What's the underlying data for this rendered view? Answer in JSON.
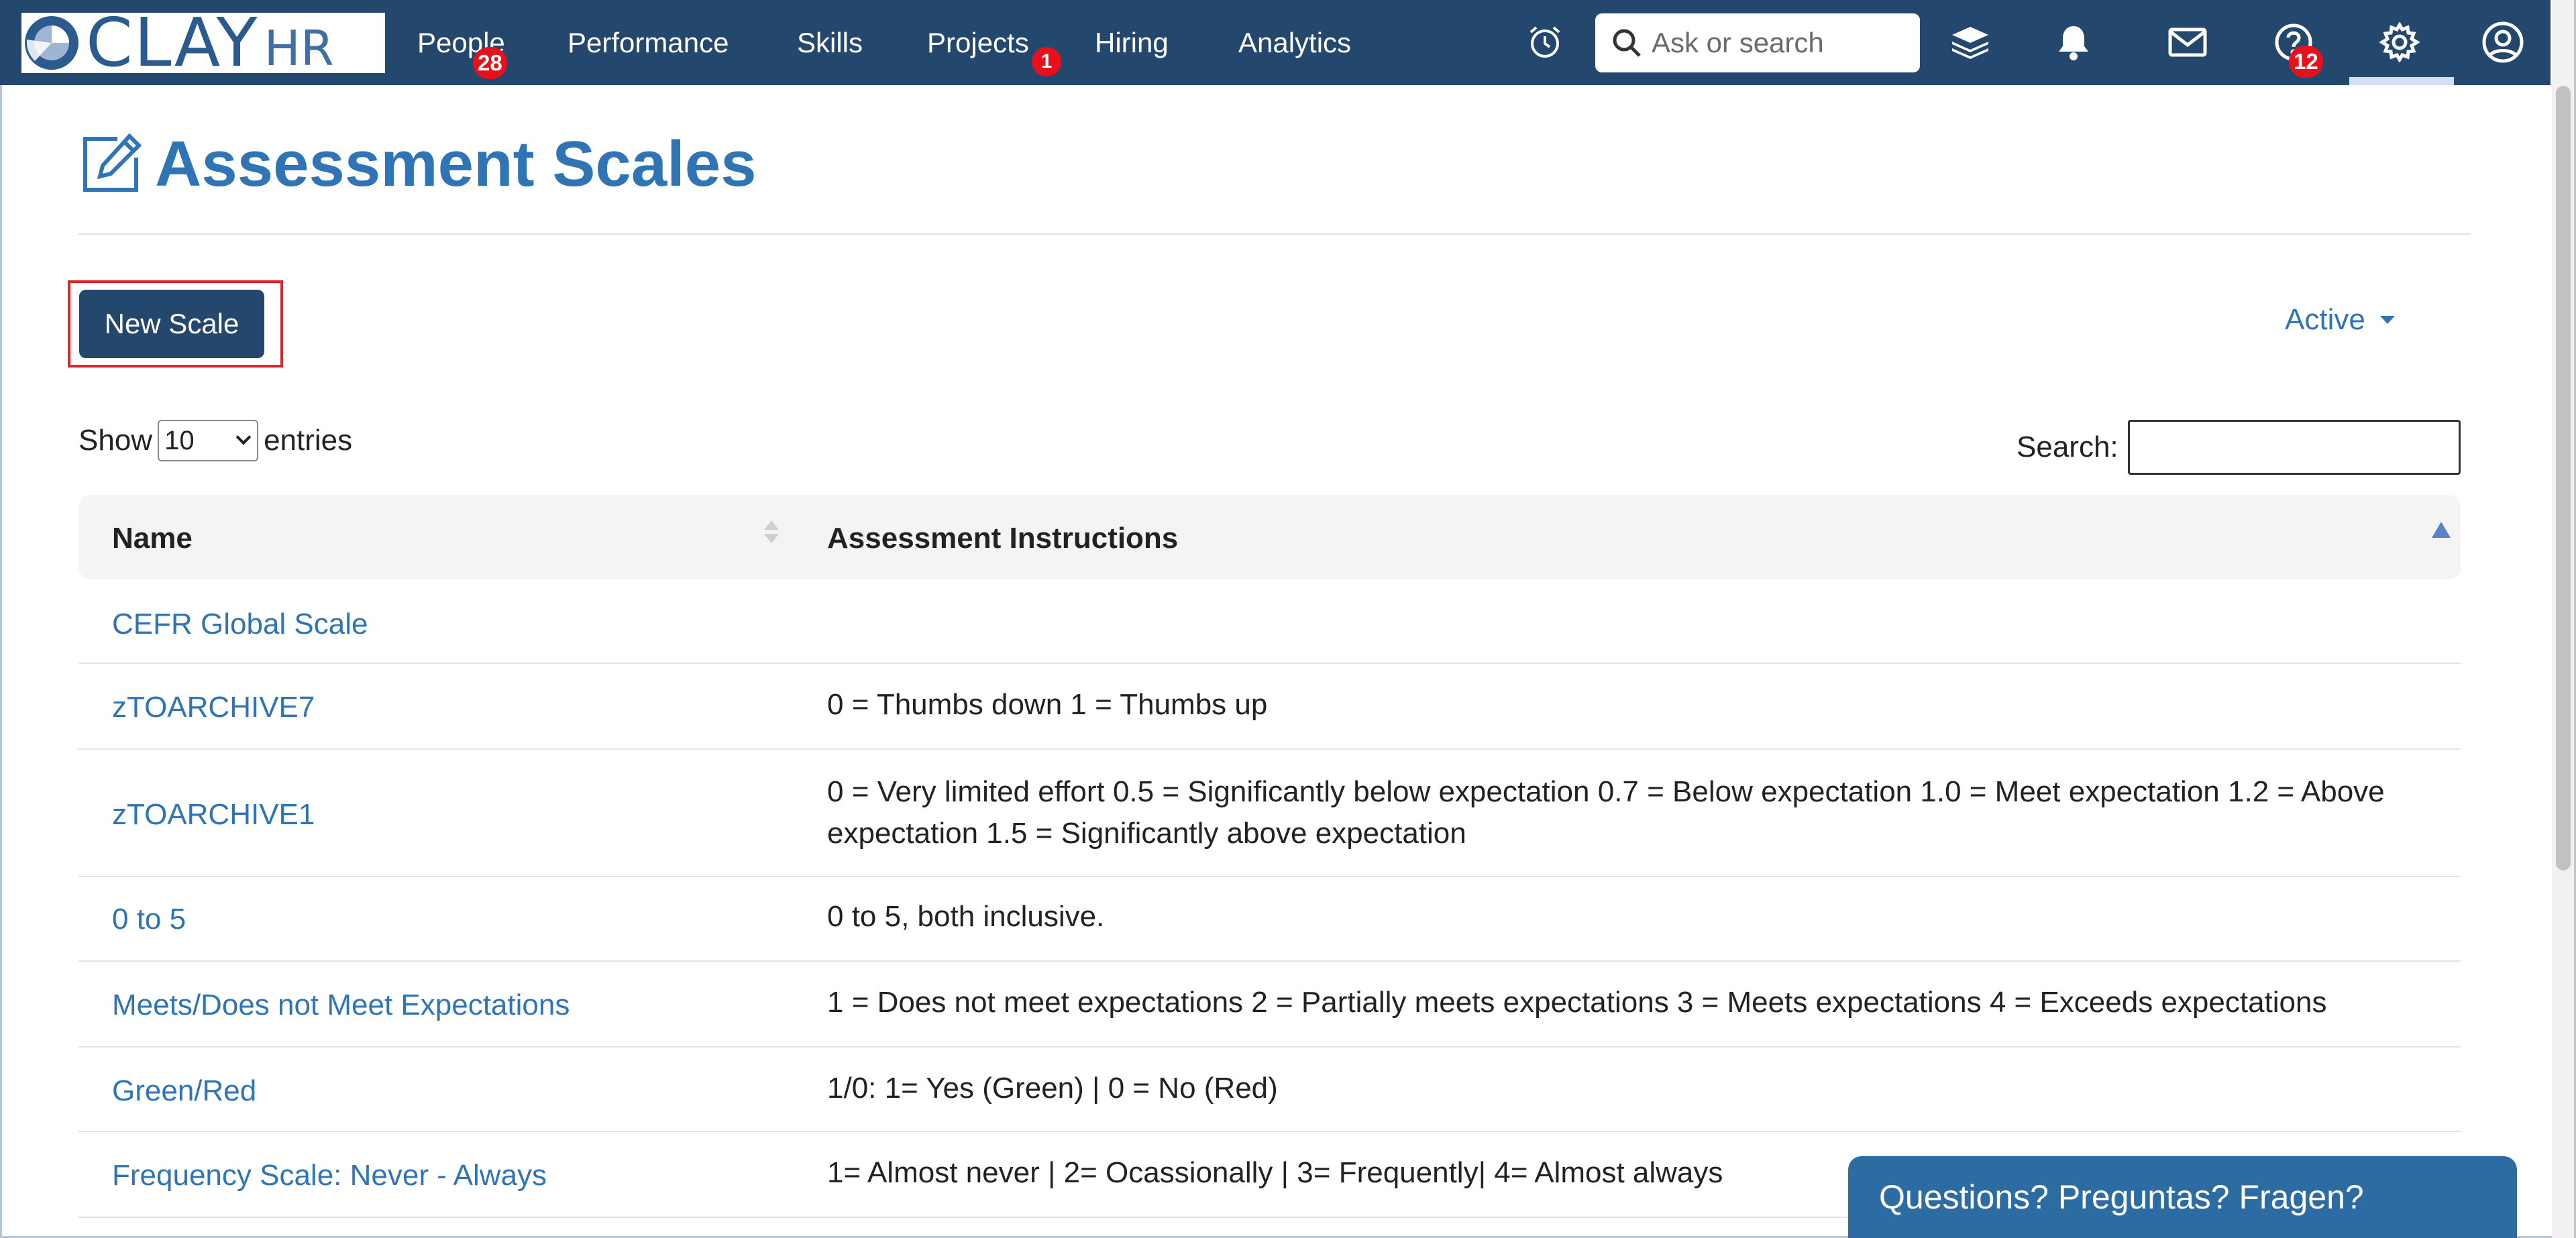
{
  "app": {
    "logo_text": "CLAY",
    "logo_suffix": "HR"
  },
  "nav": {
    "items": [
      {
        "label": "People",
        "badge": "28"
      },
      {
        "label": "Performance"
      },
      {
        "label": "Skills"
      },
      {
        "label": "Projects",
        "badge": "1"
      },
      {
        "label": "Hiring"
      },
      {
        "label": "Analytics"
      }
    ],
    "search_placeholder": "Ask or search",
    "help_badge": "12",
    "icons": [
      "alarm-clock-icon",
      "search-icon",
      "layers-icon",
      "bell-icon",
      "mail-icon",
      "help-circle-icon",
      "gear-icon",
      "user-icon"
    ]
  },
  "page": {
    "title": "Assessment Scales",
    "new_button": "New Scale",
    "status_filter": "Active",
    "show_label": "Show",
    "entries_label": "entries",
    "page_size": "10",
    "search_label": "Search:",
    "search_value": ""
  },
  "table": {
    "columns": [
      "Name",
      "Assessment Instructions"
    ],
    "rows": [
      {
        "name": "CEFR Global Scale",
        "instructions": ""
      },
      {
        "name": "zTOARCHIVE7",
        "instructions": "0 = Thumbs down 1 = Thumbs up"
      },
      {
        "name": "zTOARCHIVE1",
        "instructions": "0 = Very limited effort 0.5 = Significantly below expectation 0.7 = Below expectation 1.0 = Meet expectation 1.2 = Above expectation 1.5 = Significantly above expectation"
      },
      {
        "name": "0 to 5",
        "instructions": "0 to 5, both inclusive."
      },
      {
        "name": "Meets/Does not Meet Expectations",
        "instructions": "1 = Does not meet expectations 2 = Partially meets expectations 3 = Meets expectations 4 = Exceeds expectations"
      },
      {
        "name": "Green/Red",
        "instructions": "1/0: 1= Yes (Green) | 0 = No (Red)"
      },
      {
        "name": "Frequency Scale: Never - Always",
        "instructions": "1= Almost never | 2= Ocassionally | 3= Frequently| 4= Almost always"
      }
    ]
  },
  "help_widget": {
    "label": "Questions? Preguntas? Fragen?"
  },
  "colors": {
    "nav_bg": "#24476e",
    "link": "#2f74b5",
    "badge": "#e8111b",
    "highlight_outline": "#e2232b",
    "help_widget": "#2d6ba3"
  }
}
